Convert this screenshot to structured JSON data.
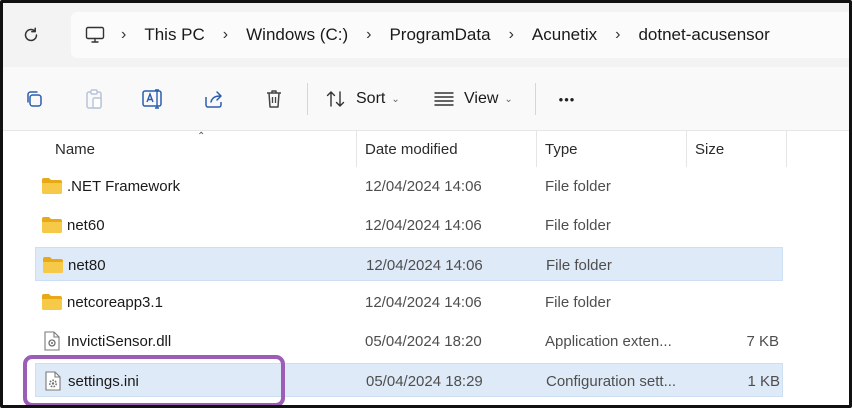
{
  "breadcrumbs": [
    "This PC",
    "Windows (C:)",
    "ProgramData",
    "Acunetix",
    "dotnet-acusensor"
  ],
  "toolbar": {
    "sort_label": "Sort",
    "view_label": "View",
    "more_label": "•••"
  },
  "columns": {
    "name": "Name",
    "date": "Date modified",
    "type": "Type",
    "size": "Size"
  },
  "files": [
    {
      "name": ".NET Framework",
      "date": "12/04/2024 14:06",
      "type": "File folder",
      "size": "",
      "icon": "folder-icon",
      "selected": false
    },
    {
      "name": "net60",
      "date": "12/04/2024 14:06",
      "type": "File folder",
      "size": "",
      "icon": "folder-icon",
      "selected": false
    },
    {
      "name": "net80",
      "date": "12/04/2024 14:06",
      "type": "File folder",
      "size": "",
      "icon": "folder-icon",
      "selected": true
    },
    {
      "name": "netcoreapp3.1",
      "date": "12/04/2024 14:06",
      "type": "File folder",
      "size": "",
      "icon": "folder-icon",
      "selected": false
    },
    {
      "name": "InvictiSensor.dll",
      "date": "05/04/2024 18:20",
      "type": "Application exten...",
      "size": "7 KB",
      "icon": "dll-file-icon",
      "selected": false
    },
    {
      "name": "settings.ini",
      "date": "05/04/2024 18:29",
      "type": "Configuration sett...",
      "size": "1 KB",
      "icon": "ini-file-icon",
      "selected": true
    }
  ],
  "colors": {
    "accent_highlight": "#9b5db5",
    "selection_bg": "#dfeaf8",
    "folder_yellow": "#f5c342"
  }
}
